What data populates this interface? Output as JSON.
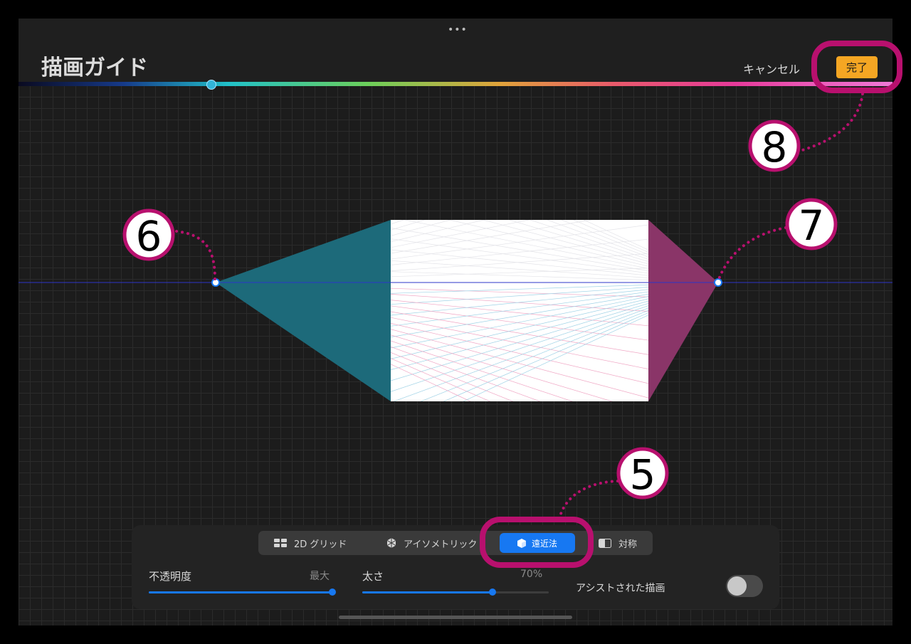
{
  "header": {
    "title": "描画ガイド",
    "cancel_label": "キャンセル",
    "done_label": "完了",
    "more_glyph": "•••"
  },
  "color_slider": {
    "value_fraction": 0.22,
    "handle_color": "#32b4d8"
  },
  "guide_modes": [
    {
      "label": "2D グリッド",
      "icon": "grid-icon"
    },
    {
      "label": "アイソメトリック",
      "icon": "isometric-cube-icon"
    },
    {
      "label": "遠近法",
      "icon": "perspective-cube-icon",
      "selected": true
    },
    {
      "label": "対称",
      "icon": "symmetry-icon"
    }
  ],
  "opacity": {
    "label": "不透明度",
    "value_text": "最大",
    "fraction": 1.0
  },
  "thickness": {
    "label": "太さ",
    "value_text": "70%",
    "fraction": 0.7
  },
  "assist": {
    "label": "アシストされた描画",
    "enabled": false
  },
  "annotations": [
    {
      "number": "5",
      "target": "perspective-mode"
    },
    {
      "number": "6",
      "target": "left-vanishing-point"
    },
    {
      "number": "7",
      "target": "right-vanishing-point"
    },
    {
      "number": "8",
      "target": "done-button"
    }
  ],
  "colors": {
    "accent": "#1778f2",
    "done_button": "#f5a623",
    "annotation": "#b8106e",
    "left_plane": "#1d6a7a",
    "right_plane": "#8a3568",
    "horizon": "#2c35c8"
  }
}
